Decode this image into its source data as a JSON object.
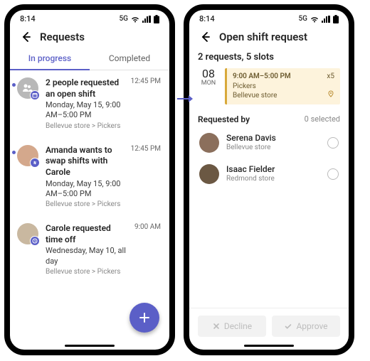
{
  "statusbar": {
    "time": "8:14",
    "network": "5G"
  },
  "screen1": {
    "title": "Requests",
    "tabs": {
      "inprogress": "In progress",
      "completed": "Completed"
    },
    "items": [
      {
        "title": "2 people requested an open shift",
        "sub": "Monday, May 15, 9:00 AM–5:00 PM",
        "meta": "Bellevue store > Pickers",
        "time": "12:45 PM"
      },
      {
        "title": "Amanda wants to swap shifts with Carole",
        "sub": "Monday, May 15, 9:00 AM–5:00 PM",
        "meta": "Bellevue store > Pickers",
        "time": "12:45 PM"
      },
      {
        "title": "Carole requested time off",
        "sub": "Wednesday, May 10, all day",
        "meta": "Bellevue store > Pickers",
        "time": "9:00 AM"
      }
    ]
  },
  "screen2": {
    "title": "Open shift request",
    "summary": "2 requests, 5 slots",
    "date": {
      "num": "08",
      "day": "MON"
    },
    "shift": {
      "time": "9:00 AM–5:00 PM",
      "group": "Pickers",
      "store": "Bellevue store",
      "count": "x5"
    },
    "reqby_label": "Requested by",
    "selected_label": "0 selected",
    "people": [
      {
        "name": "Serena Davis",
        "store": "Bellevue store"
      },
      {
        "name": "Isaac Fielder",
        "store": "Redmond store"
      }
    ],
    "decline": "Decline",
    "approve": "Approve"
  }
}
